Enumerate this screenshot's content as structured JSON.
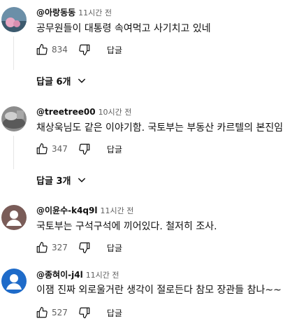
{
  "comments": [
    {
      "author": "@아랑동동",
      "time": "11시간 전",
      "text": "공무원들이 대통령 속여먹고 사기치고 있네",
      "likes": "834",
      "reply_label": "답글",
      "replies_label": "답글 6개",
      "avatar_icon": "landscape-avatar",
      "avatar_colors": [
        "#6b8fa8",
        "#e9a7c3",
        "#3d5a6e"
      ]
    },
    {
      "author": "@treetree00",
      "time": "10시간 전",
      "text": "채상욱님도 같은 이야기함. 국토부는 부동산 카르텔의 본진임",
      "likes": "347",
      "reply_label": "답글",
      "replies_label": "답글 3개",
      "avatar_icon": "photo-avatar",
      "avatar_colors": [
        "#8c8c8c",
        "#cfcfcf",
        "#5a5a5a"
      ]
    },
    {
      "author": "@이윤수-k4q9l",
      "time": "11시간 전",
      "text": "국토부는 구석구석에 끼어있다. 철저히 조사.",
      "likes": "327",
      "reply_label": "답글",
      "avatar_icon": "default-user-avatar",
      "avatar_colors": [
        "#7a5c58",
        "#ffffff"
      ]
    },
    {
      "author": "@종혀이-j4l",
      "time": "11시간 전",
      "text": "이잼 진짜 외로울거란 생각이 절로든다 참모 장관들 참나~~",
      "likes": "527",
      "reply_label": "답글",
      "avatar_icon": "default-user-avatar",
      "avatar_colors": [
        "#1e6bc9",
        "#ffffff"
      ]
    }
  ]
}
